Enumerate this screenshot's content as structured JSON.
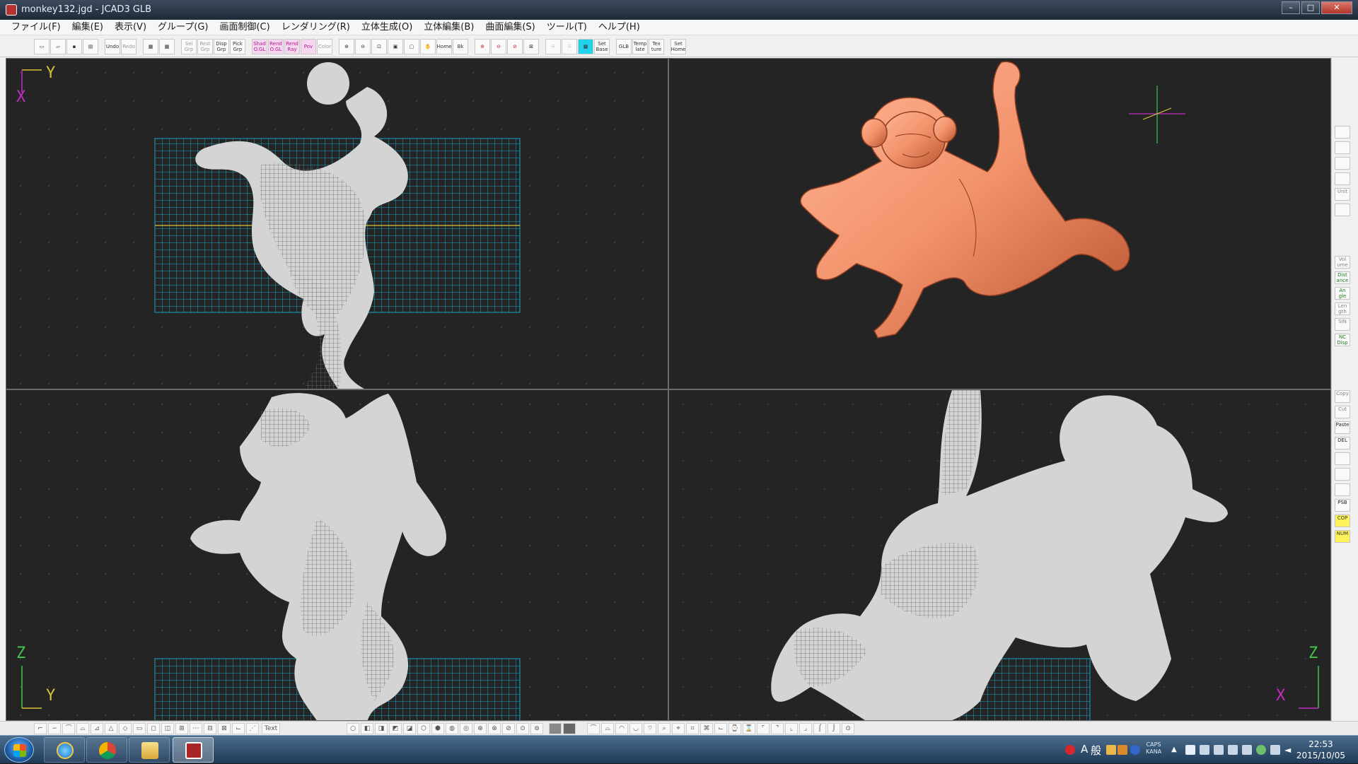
{
  "window": {
    "title": "monkey132.jgd - JCAD3 GLB",
    "controls": {
      "minimize": "–",
      "maximize": "□",
      "close": "✕"
    }
  },
  "menu": [
    "ファイル(F)",
    "編集(E)",
    "表示(V)",
    "グループ(G)",
    "画面制御(C)",
    "レンダリング(R)",
    "立体生成(O)",
    "立体編集(B)",
    "曲面編集(S)",
    "ツール(T)",
    "ヘルプ(H)"
  ],
  "toolbar": {
    "group1": [
      "",
      "",
      "",
      ""
    ],
    "undo": "Undo",
    "redo": "Redo",
    "group_buttons": [
      "Sel Grp",
      "Rest Grp",
      "Disp Grp",
      "Pick Grp"
    ],
    "render_buttons": [
      "Shad O.GL",
      "Rend O.GL",
      "Rend Ray",
      "Pov",
      "Color"
    ],
    "view_buttons": [
      "Home",
      "Bk"
    ],
    "set_base": "Set Base",
    "glb": "GLB",
    "template": "Temp late",
    "texture": "Tex ture",
    "set_home": "Set Home"
  },
  "viewports": {
    "top_left": {
      "axis_v": "Y",
      "axis_h": "X"
    },
    "top_right": {},
    "bottom_left": {
      "axis_v": "Z",
      "axis_h": "Y"
    },
    "bottom_right": {
      "axis_v": "Z",
      "axis_h": "X"
    }
  },
  "sidebar": {
    "top": [
      "",
      "",
      "",
      "",
      "Unit",
      ""
    ],
    "measure": [
      "Vol ume",
      "Dist ance",
      "An gle",
      "Len gth",
      "SIN",
      "NC Disp"
    ],
    "edit": [
      "Copy",
      "Cut",
      "Paste",
      "DEL",
      "",
      "",
      "",
      "PSB",
      "COP",
      "NUM"
    ]
  },
  "bottombar": {
    "text_button": "Text"
  },
  "taskbar": {
    "ime_lang": "A",
    "ime_mode": "般",
    "caps": "CAPS",
    "kana": "KANA",
    "time": "22:53",
    "date": "2015/10/05"
  },
  "colors": {
    "viewport_bg": "#242424",
    "grid": "#1aa3c7",
    "wireframe": "#d4d4d4",
    "render": "#f2926b",
    "axis_y": "#d8c23a",
    "axis_x": "#c22ec2",
    "axis_z": "#42c84a"
  },
  "icons": [
    "new-file-icon",
    "open-folder-icon",
    "save-icon",
    "print-icon",
    "zoom-in-icon",
    "zoom-out-icon",
    "pan-hand-icon",
    "windows-start-icon",
    "ie-icon",
    "chrome-icon",
    "explorer-icon",
    "jcad-icon"
  ]
}
